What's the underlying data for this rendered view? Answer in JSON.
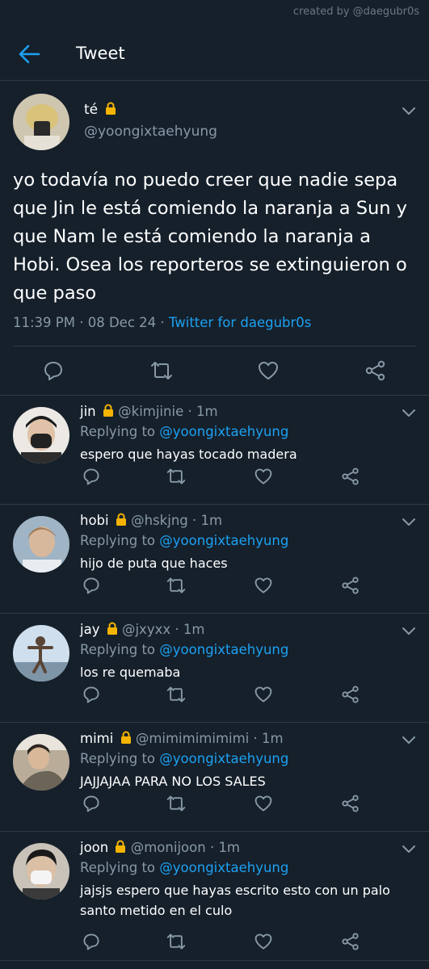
{
  "watermark": "created by @daegubr0s",
  "header": {
    "title": "Tweet"
  },
  "tweet": {
    "name": "té",
    "handle": "@yoongixtaehyung",
    "text": "yo todavía no puedo creer que nadie sepa que Jin le está comiendo la naranja a Sun y que Nam le está comiendo la naranja a Hobi. Osea los reporteros se extinguieron o que paso",
    "time": "11:39 PM",
    "date": "08 Dec 24",
    "client": "Twitter for daegubr0s"
  },
  "replies": [
    {
      "name": "jin",
      "handle": "@kimjinie",
      "time": "1m",
      "replying_label": "Replying to",
      "replying_to": "@yoongixtaehyung",
      "text": "espero que hayas tocado madera"
    },
    {
      "name": "hobi",
      "handle": "@hskjng",
      "time": "1m",
      "replying_label": "Replying to",
      "replying_to": "@yoongixtaehyung",
      "text": "hijo de puta que haces"
    },
    {
      "name": "jay",
      "handle": "@jxyxx",
      "time": "1m",
      "replying_label": "Replying to",
      "replying_to": "@yoongixtaehyung",
      "text": "los re quemaba"
    },
    {
      "name": "mimi",
      "handle": "@mimimimimimi",
      "time": "1m",
      "replying_label": "Replying to",
      "replying_to": "@yoongixtaehyung",
      "text": "JAJJAJAA PARA NO LOS SALES"
    },
    {
      "name": "joon",
      "handle": "@monijoon",
      "time": "1m",
      "replying_label": "Replying to",
      "replying_to": "@yoongixtaehyung",
      "text": "jajsjs espero que hayas escrito esto con un palo santo metido en el culo"
    }
  ],
  "colors": {
    "background": "#15202b",
    "accent": "#1da1f2",
    "secondary_text": "#8899a6",
    "divider": "#2f3a45"
  },
  "icons": [
    "back-arrow-icon",
    "lock-icon",
    "chevron-down-icon",
    "reply-icon",
    "retweet-icon",
    "like-icon",
    "share-icon"
  ]
}
